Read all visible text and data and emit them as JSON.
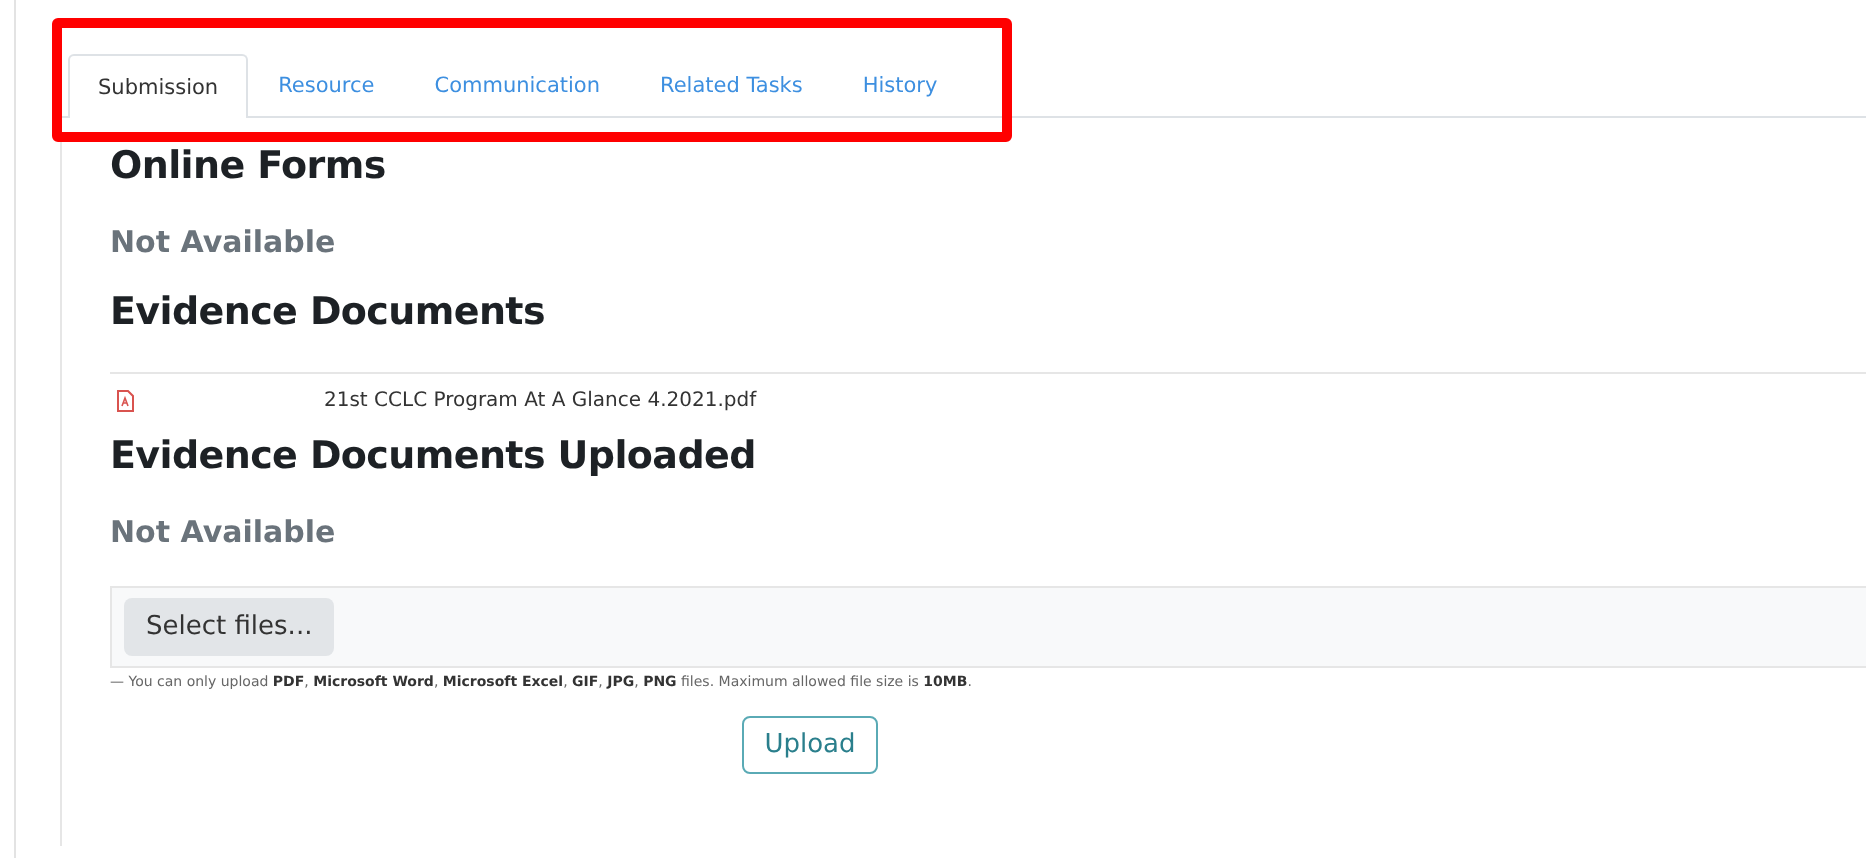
{
  "tabs": [
    {
      "label": "Submission",
      "selected": true
    },
    {
      "label": "Resource",
      "selected": false
    },
    {
      "label": "Communication",
      "selected": false
    },
    {
      "label": "Related Tasks",
      "selected": false
    },
    {
      "label": "History",
      "selected": false
    }
  ],
  "highlight": {
    "color": "#ff0000"
  },
  "sections": [
    {
      "kind": "status",
      "heading": "Online Forms",
      "text": "Not Available"
    },
    {
      "kind": "files",
      "heading": "Evidence Documents",
      "files": [
        "21st CCLC Program At A Glance 4.2021.pdf"
      ]
    },
    {
      "kind": "status",
      "heading": "Evidence Documents Uploaded",
      "text": "Not Available"
    }
  ],
  "upload": {
    "select_button": "Select files...",
    "hint": "— You can only upload **PDF**, **Microsoft Word**, **Microsoft Excel**, **GIF**, **JPG**, **PNG** files. Maximum allowed file size is **10MB**.",
    "upload_button": "Upload"
  }
}
